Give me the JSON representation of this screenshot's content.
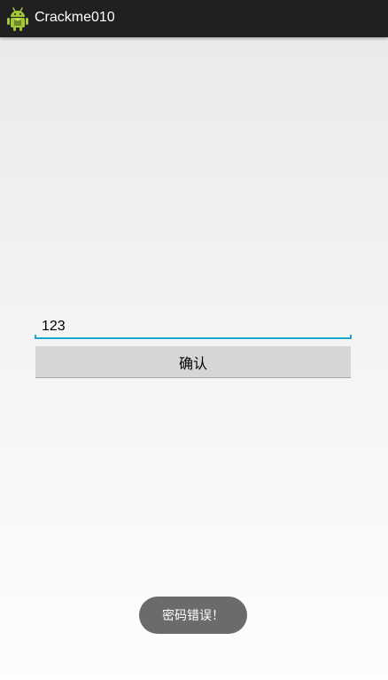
{
  "app": {
    "title": "Crackme010",
    "icon": "android-icon",
    "accent_color": "#1aa6cf",
    "bar_color": "#202020"
  },
  "form": {
    "password_value": "123",
    "confirm_label": "确认"
  },
  "toast": {
    "message": "密码错误！"
  }
}
